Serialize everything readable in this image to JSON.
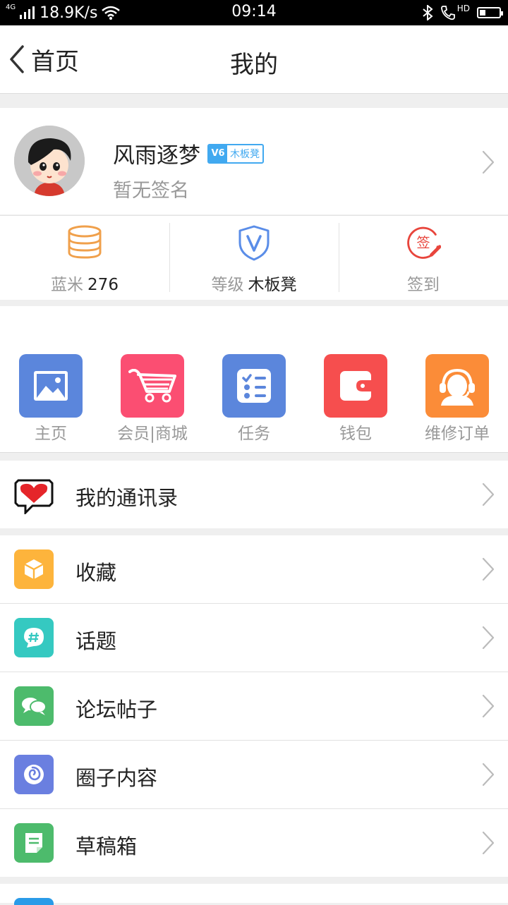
{
  "status_bar": {
    "network": "4G",
    "speed": "18.9K/s",
    "time": "09:14",
    "hd_label": "HD",
    "battery_level": 0.3
  },
  "nav": {
    "back_label": "首页",
    "title": "我的"
  },
  "profile": {
    "username": "风雨逐梦",
    "badge_icon": "V6",
    "badge_text": "木板凳",
    "signature": "暂无签名"
  },
  "stats": [
    {
      "label": "蓝米",
      "value": "276",
      "icon": "coins-stack-icon",
      "color": "#f0a04b"
    },
    {
      "label": "等级",
      "value": "木板凳",
      "icon": "shield-v-icon",
      "color": "#5a8de8"
    },
    {
      "label": "签到",
      "value": "",
      "icon": "checkin-sign-icon",
      "color": "#e8453c",
      "icon_text": "签"
    }
  ],
  "shortcuts": [
    {
      "label": "主页",
      "icon": "image-icon",
      "color": "#5b86dc"
    },
    {
      "label": "会员|商城",
      "icon": "shopping-cart-icon",
      "color": "#fb4e72"
    },
    {
      "label": "任务",
      "icon": "task-list-icon",
      "color": "#5b86dc"
    },
    {
      "label": "钱包",
      "icon": "wallet-icon",
      "color": "#f64e4e"
    },
    {
      "label": "维修订单",
      "icon": "service-agent-icon",
      "color": "#fb8c38"
    }
  ],
  "list": {
    "contacts": {
      "label": "我的通讯录",
      "icon": "heart-speech-icon"
    },
    "items": [
      {
        "label": "收藏",
        "icon": "box-icon",
        "color": "#fdb43c"
      },
      {
        "label": "话题",
        "icon": "hashtag-bubble-icon",
        "color": "#35c9c1"
      },
      {
        "label": "论坛帖子",
        "icon": "chat-bubbles-icon",
        "color": "#4dbb6c"
      },
      {
        "label": "圈子内容",
        "icon": "spiral-icon",
        "color": "#6a7fe0"
      },
      {
        "label": "草稿箱",
        "icon": "draft-note-icon",
        "color": "#4dbb6c"
      }
    ]
  }
}
